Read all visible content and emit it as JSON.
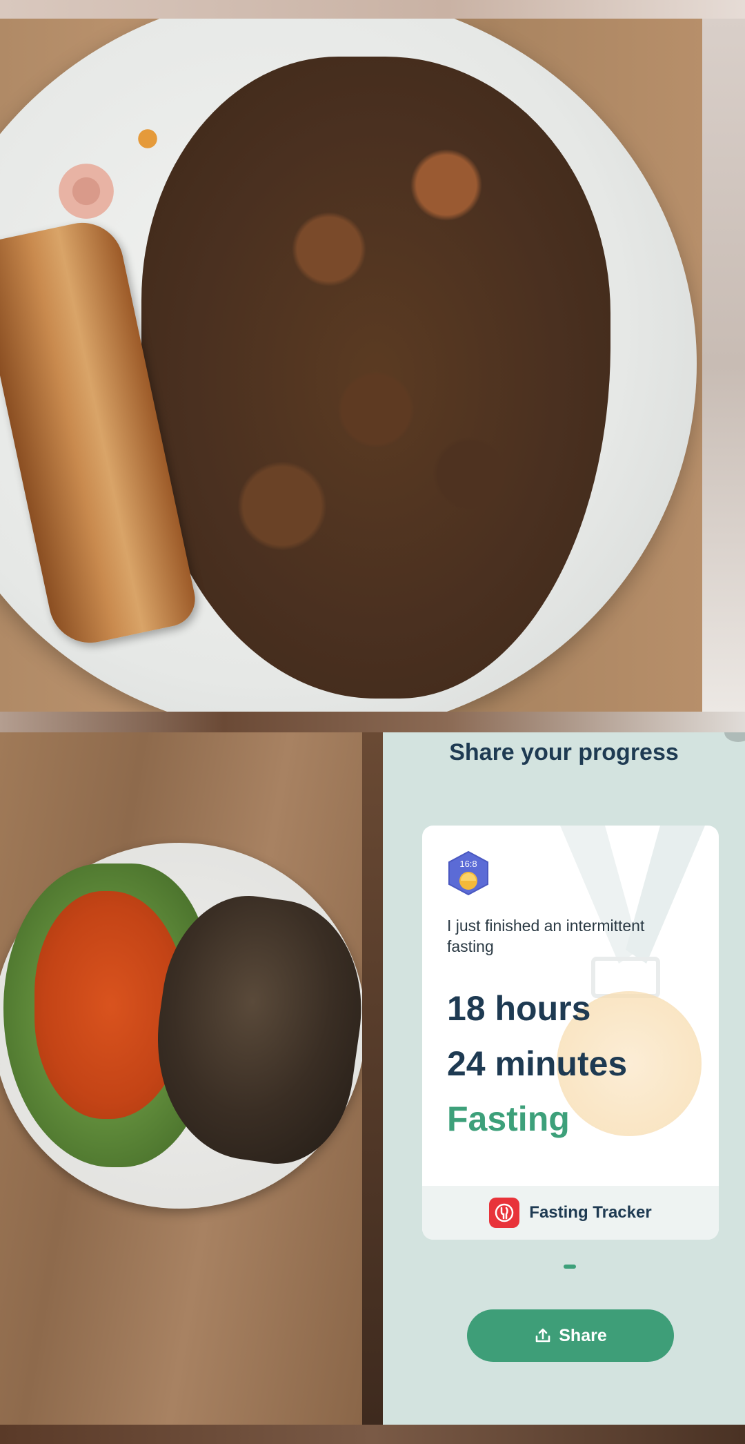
{
  "share_panel": {
    "title": "Share your progress",
    "card": {
      "badge_label": "16:8",
      "message": "I just finished an intermittent fasting",
      "hours_line": "18 hours",
      "minutes_line": "24 minutes",
      "status_line": "Fasting",
      "app_name": "Fasting Tracker"
    },
    "share_button_label": "Share"
  },
  "colors": {
    "panel_background": "#d3e3df",
    "title_text": "#1e3a52",
    "accent_green": "#3da07a",
    "button_green": "#3e9e78",
    "app_icon_red": "#e8333a"
  },
  "icons": {
    "badge": "hexagon-clock-badge-icon",
    "app": "fork-spoon-icon",
    "share": "upload-icon"
  }
}
